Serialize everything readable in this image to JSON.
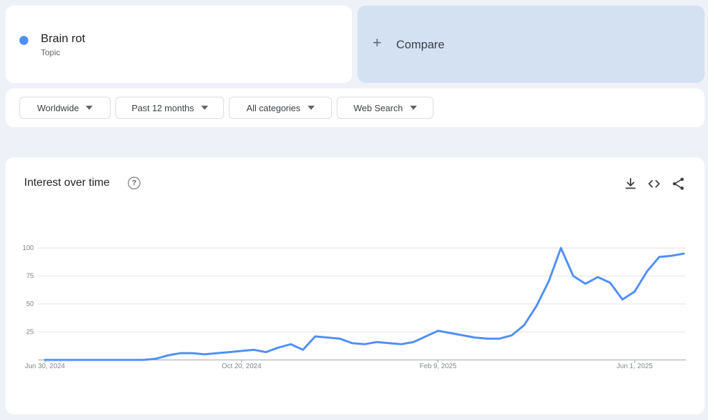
{
  "term": {
    "name": "Brain rot",
    "type": "Topic",
    "color": "#4f8ff7"
  },
  "compare": {
    "label": "Compare"
  },
  "filters": [
    {
      "label": "Worldwide"
    },
    {
      "label": "Past 12 months"
    },
    {
      "label": "All categories"
    },
    {
      "label": "Web Search"
    }
  ],
  "chart": {
    "title": "Interest over time",
    "tools": [
      "download-icon",
      "embed-code-icon",
      "share-icon"
    ]
  },
  "chart_data": {
    "type": "line",
    "title": "",
    "xlabel": "",
    "ylabel": "",
    "ylim": [
      0,
      100
    ],
    "yticks": [
      25,
      50,
      75,
      100
    ],
    "x_tick_labels": [
      "Jun 30, 2024",
      "Oct 20, 2024",
      "Feb 9, 2025",
      "Jun 1, 2025"
    ],
    "x_tick_index": [
      0,
      16,
      32,
      48
    ],
    "grid": true,
    "series": [
      {
        "color": "#4f8ff7",
        "values": [
          0,
          0,
          0,
          0,
          0,
          0,
          0,
          0,
          0,
          1,
          4,
          6,
          6,
          5,
          6,
          7,
          8,
          9,
          7,
          11,
          14,
          9,
          21,
          20,
          19,
          15,
          14,
          16,
          15,
          14,
          16,
          21,
          26,
          24,
          22,
          20,
          19,
          19,
          22,
          31,
          48,
          70,
          100,
          75,
          68,
          74,
          69,
          54,
          61,
          79,
          92,
          93,
          95
        ]
      }
    ]
  }
}
